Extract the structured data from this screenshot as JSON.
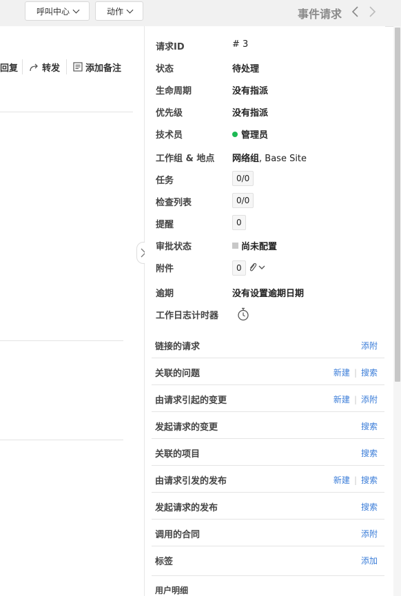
{
  "toolbar": {
    "call_center_label": "呼叫中心",
    "actions_label": "动作",
    "page_title": "事件请求"
  },
  "left": {
    "reply_label": "回复",
    "forward_label": "转发",
    "add_note_label": "添加备注"
  },
  "properties": {
    "request_id": {
      "label": "请求ID",
      "value": "# 3"
    },
    "status": {
      "label": "状态",
      "value": "待处理"
    },
    "lifecycle": {
      "label": "生命周期",
      "value": "没有指派"
    },
    "priority": {
      "label": "优先级",
      "value": "没有指派"
    },
    "technician": {
      "label": "技术员",
      "value": "管理员",
      "status_color": "#1db954"
    },
    "group_site": {
      "label": "工作组 & 地点",
      "group": "网络组",
      "site": ", Base Site"
    },
    "tasks": {
      "label": "任务",
      "value": "0/0"
    },
    "checklist": {
      "label": "检查列表",
      "value": "0/0"
    },
    "reminders": {
      "label": "提醒",
      "value": "0"
    },
    "approval": {
      "label": "审批状态",
      "value": "尚未配置"
    },
    "attachments": {
      "label": "附件",
      "value": "0"
    },
    "due": {
      "label": "逾期",
      "value": "没有设置逾期日期"
    },
    "worklog_timer": {
      "label": "工作日志计时器"
    }
  },
  "sections": {
    "linked_requests": {
      "title": "链接的请求",
      "attach": "添附"
    },
    "related_problems": {
      "title": "关联的问题",
      "new": "新建",
      "search": "搜索"
    },
    "caused_changes": {
      "title": "由请求引起的变更",
      "new": "新建",
      "attach": "添附"
    },
    "initiated_changes": {
      "title": "发起请求的变更",
      "search": "搜索"
    },
    "related_projects": {
      "title": "关联的项目",
      "search": "搜索"
    },
    "caused_releases": {
      "title": "由请求引发的发布",
      "new": "新建",
      "search": "搜索"
    },
    "initiated_releases": {
      "title": "发起请求的发布",
      "search": "搜索"
    },
    "contracts": {
      "title": "调用的合同",
      "attach": "添附"
    },
    "tags": {
      "title": "标签",
      "add": "添加"
    },
    "user_details": {
      "title": "用户明细"
    }
  },
  "colors": {
    "link": "#3b7dd8",
    "technician_online": "#1db954"
  }
}
